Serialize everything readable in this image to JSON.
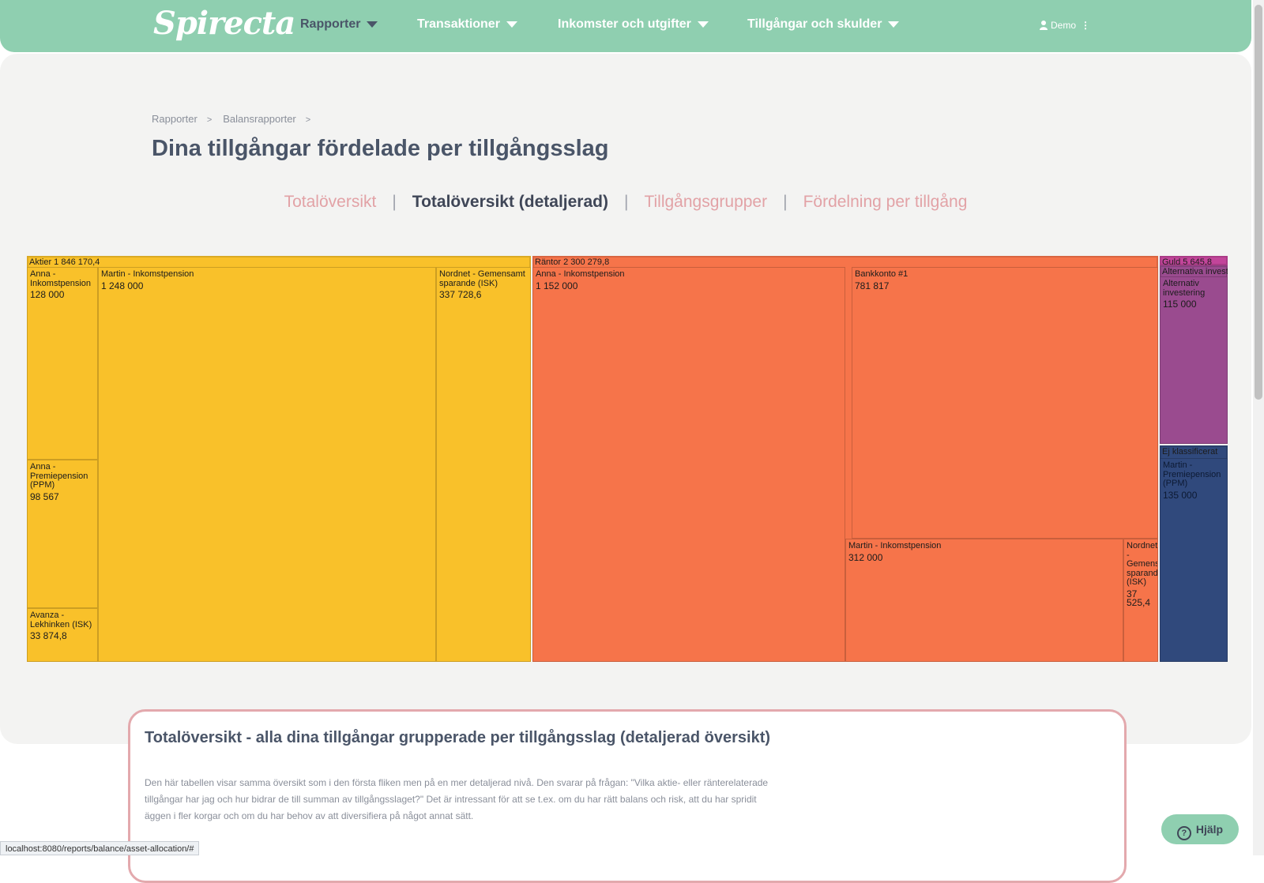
{
  "nav": {
    "logo": "Spirecta",
    "items": [
      {
        "label": "Rapporter",
        "active": true
      },
      {
        "label": "Transaktioner",
        "active": false
      },
      {
        "label": "Inkomster och utgifter",
        "active": false
      },
      {
        "label": "Tillgångar och skulder",
        "active": false
      }
    ],
    "user": "Demo"
  },
  "breadcrumbs": [
    "Rapporter",
    "Balansrapporter"
  ],
  "page_title": "Dina tillgångar fördelade per tillgångsslag",
  "tabs": [
    {
      "label": "Totalöversikt",
      "active": false
    },
    {
      "label": "Totalöversikt (detaljerad)",
      "active": true
    },
    {
      "label": "Tillgångsgrupper",
      "active": false
    },
    {
      "label": "Fördelning per tillgång",
      "active": false
    }
  ],
  "chart_data": {
    "type": "treemap",
    "groups": [
      {
        "name": "Aktier",
        "total_label": "1 846 170,4",
        "color": "#f9c12a",
        "items": [
          {
            "name": "Anna - Inkomstpension",
            "value": 128000,
            "label": "128 000"
          },
          {
            "name": "Anna - Premiepension (PPM)",
            "value": 98567,
            "label": "98 567"
          },
          {
            "name": "Avanza - Lekhinken (ISK)",
            "value": 33874.8,
            "label": "33 874,8"
          },
          {
            "name": "Martin - Inkomstpension",
            "value": 1248000,
            "label": "1 248 000"
          },
          {
            "name": "Nordnet - Gemensamt sparande (ISK)",
            "value": 337728.6,
            "label": "337 728,6"
          }
        ]
      },
      {
        "name": "Räntor",
        "total_label": "2 300 279,8",
        "color": "#f6744a",
        "items": [
          {
            "name": "Anna - Inkomstpension",
            "value": 1152000,
            "label": "1 152 000"
          },
          {
            "name": "Bankkonto #1",
            "value": 781817,
            "label": "781 817"
          },
          {
            "name": "Martin - Inkomstpension",
            "value": 312000,
            "label": "312 000"
          },
          {
            "name": "Nordnet - Gemensamt sparande (ISK)",
            "value": 37525.4,
            "label": "37 525,4"
          }
        ]
      },
      {
        "name": "Guld",
        "total_label": "5 645,8",
        "color": "#c2459a",
        "items": []
      },
      {
        "name": "Alternativa investeringar",
        "total_label": "",
        "color": "#9a4b8f",
        "items": [
          {
            "name": "Alternativ investering",
            "value": 115000,
            "label": "115 000"
          }
        ]
      },
      {
        "name": "Ej klassificerat",
        "total_label": "",
        "color": "#30497c",
        "items": [
          {
            "name": "Martin - Premiepension (PPM)",
            "value": 135000,
            "label": "135 000"
          }
        ]
      }
    ]
  },
  "info_card": {
    "title": "Totalöversikt - alla dina tillgångar grupperade per tillgångsslag (detaljerad översikt)",
    "text": "Den här tabellen visar samma översikt som i den första fliken men på en mer detaljerad nivå. Den svarar på frågan: \"Vilka aktie- eller ränterelaterade tillgångar har jag och hur bidrar de till summan av tillgångsslaget?\" Det är intressant för att se t.ex. om du har rätt balans och risk, att du har spridit äggen i fler korgar och om du har behov av att diversifiera på något annat sätt."
  },
  "status_url": "localhost:8080/reports/balance/asset-allocation/#",
  "help_label": "Hjälp"
}
